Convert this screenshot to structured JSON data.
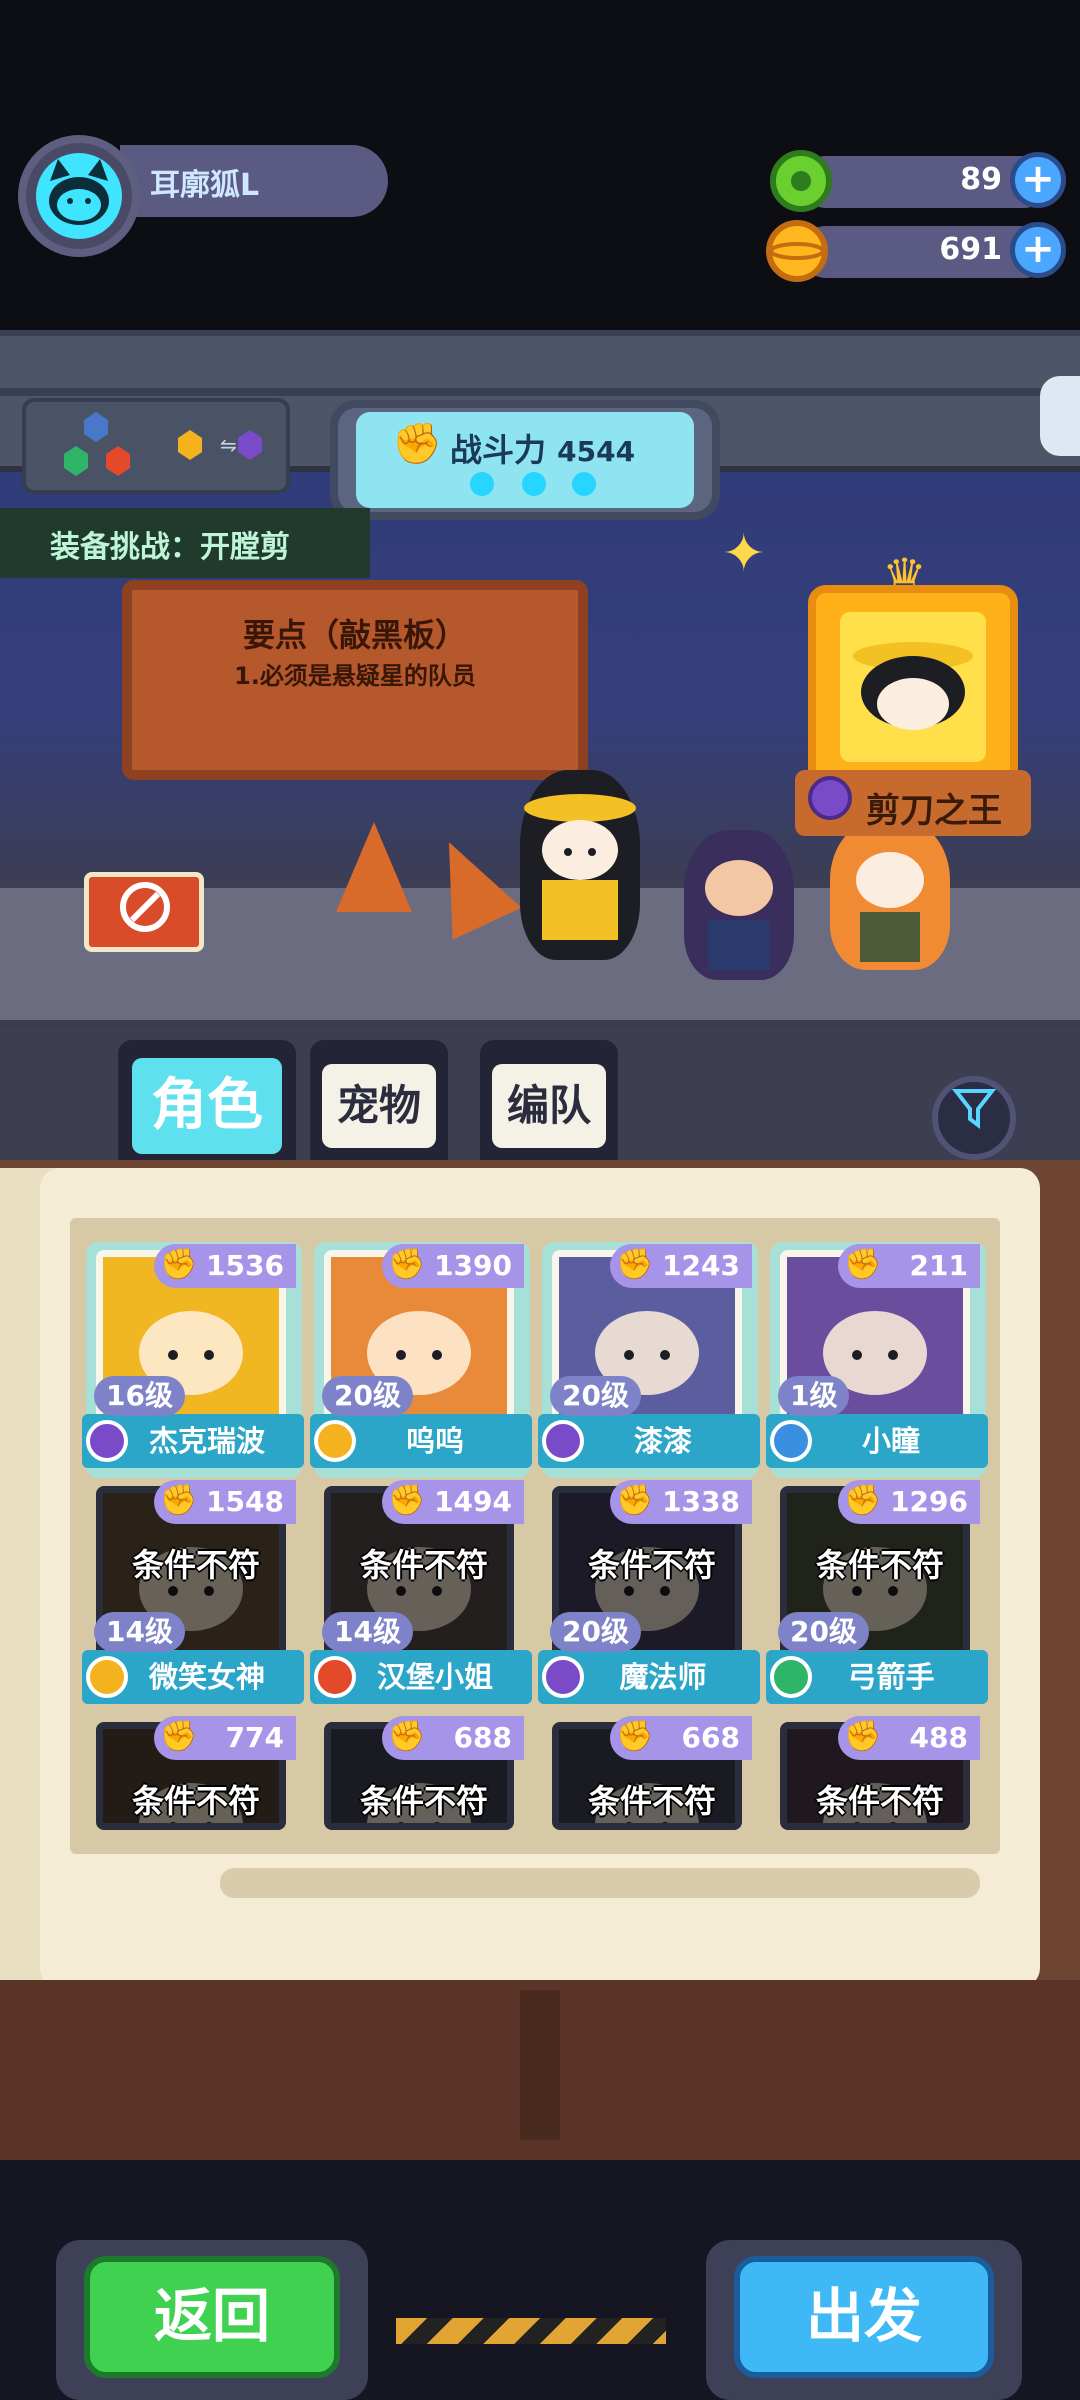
{
  "player": {
    "name": "耳廓狐L"
  },
  "resources": [
    {
      "icon": "green-donut-icon",
      "value": "89"
    },
    {
      "icon": "gold-planet-coin-icon",
      "value": "691"
    }
  ],
  "hud": {
    "power_label": "战斗力",
    "power_value": "4544",
    "challenge": "装备挑战：开膛剪"
  },
  "notice": {
    "title": "要点（敲黑板）",
    "rule": "1.必须是悬疑星的队员"
  },
  "king": {
    "label": "剪刀之王"
  },
  "tabs": [
    {
      "label": "角色",
      "active": true
    },
    {
      "label": "宠物",
      "active": false
    },
    {
      "label": "编队",
      "active": false
    }
  ],
  "blocked_text": "条件不符",
  "roster": [
    {
      "power": "1536",
      "level": "16级",
      "name": "杰克瑞波",
      "badge": "#7a4bc8",
      "portrait": "#f0b722",
      "eligible": true
    },
    {
      "power": "1390",
      "level": "20级",
      "name": "呜呜",
      "badge": "#f4b31e",
      "portrait": "#e98a3b",
      "eligible": true
    },
    {
      "power": "1243",
      "level": "20级",
      "name": "漆漆",
      "badge": "#7a4bc8",
      "portrait": "#5c5d9e",
      "eligible": true
    },
    {
      "power": "211",
      "level": "1级",
      "name": "小瞳",
      "badge": "#3b8fe0",
      "portrait": "#6a4d9c",
      "eligible": true
    },
    {
      "power": "1548",
      "level": "14级",
      "name": "微笑女神",
      "badge": "#f4b31e",
      "portrait": "#5d4a36",
      "eligible": false
    },
    {
      "power": "1494",
      "level": "14级",
      "name": "汉堡小姐",
      "badge": "#e34a2a",
      "portrait": "#4e4444",
      "eligible": false
    },
    {
      "power": "1338",
      "level": "20级",
      "name": "魔法师",
      "badge": "#7a4bc8",
      "portrait": "#3b3a55",
      "eligible": false
    },
    {
      "power": "1296",
      "level": "20级",
      "name": "弓箭手",
      "badge": "#2fb56a",
      "portrait": "#444e3a",
      "eligible": false
    },
    {
      "power": "774",
      "eligible": false,
      "portrait": "#4c3d30"
    },
    {
      "power": "688",
      "eligible": false,
      "portrait": "#3a3c4c"
    },
    {
      "power": "668",
      "eligible": false,
      "portrait": "#3a3c4c"
    },
    {
      "power": "488",
      "eligible": false,
      "portrait": "#463444"
    }
  ],
  "buttons": {
    "back": "返回",
    "go": "出发"
  },
  "colors": {
    "accent_cyan": "#3fe4ff",
    "name_bar": "#2ba5c8",
    "power_tag": "#a594e8"
  }
}
